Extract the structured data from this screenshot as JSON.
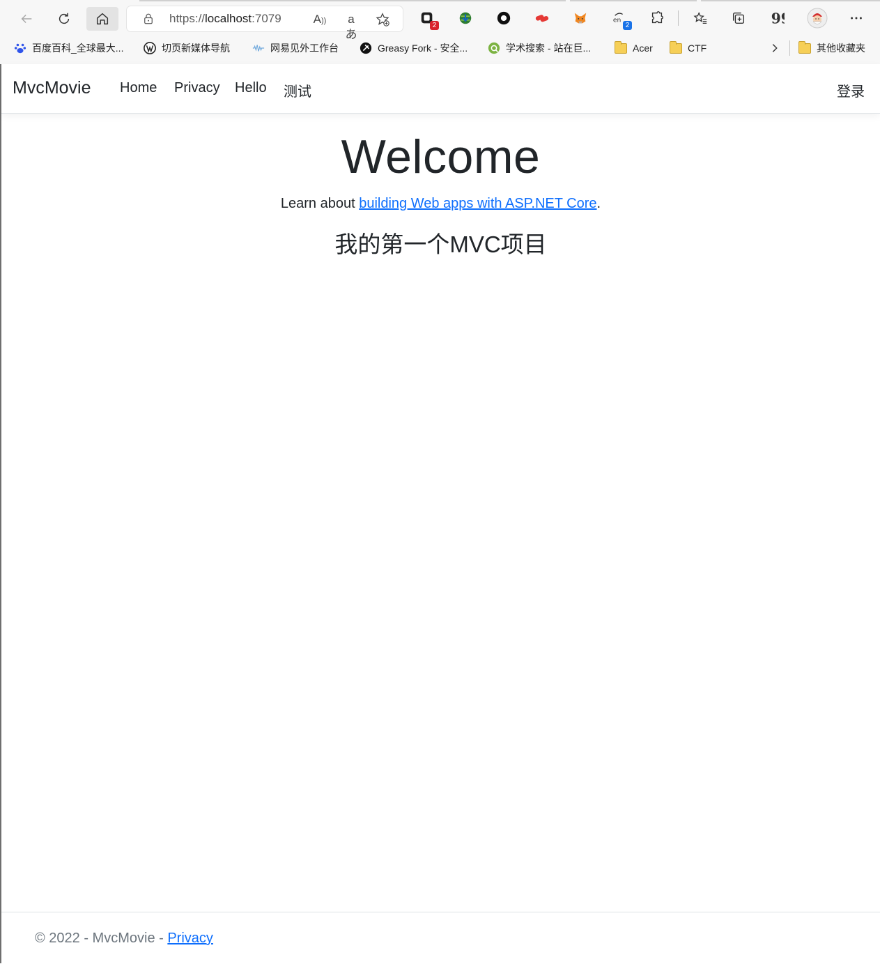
{
  "browser": {
    "address": {
      "url_prefix": "https://",
      "url_host": "localhost",
      "url_port": ":7079"
    },
    "extensions": [
      {
        "name": "extension-1",
        "badge": "2"
      },
      {
        "name": "extension-translate",
        "badge": "2"
      }
    ],
    "bookmarks": [
      {
        "label": "百度百科_全球最大..."
      },
      {
        "label": "切页新媒体导航"
      },
      {
        "label": "网易见外工作台"
      },
      {
        "label": "Greasy Fork - 安全..."
      },
      {
        "label": "学术搜索 - 站在巨..."
      },
      {
        "label": "Acer"
      },
      {
        "label": "CTF"
      }
    ],
    "other_bookmarks": "其他收藏夹"
  },
  "navbar": {
    "brand": "MvcMovie",
    "links": [
      "Home",
      "Privacy",
      "Hello",
      "测试"
    ],
    "login": "登录"
  },
  "main": {
    "title": "Welcome",
    "learn_prefix": "Learn about ",
    "learn_link": "building Web apps with ASP.NET Core",
    "learn_suffix": ".",
    "subtitle": "我的第一个MVC项目"
  },
  "footer": {
    "text": "© 2022 - MvcMovie - ",
    "link": "Privacy"
  },
  "colors": {
    "link": "#0d6efd",
    "text": "#212529",
    "muted": "#6c757d"
  }
}
